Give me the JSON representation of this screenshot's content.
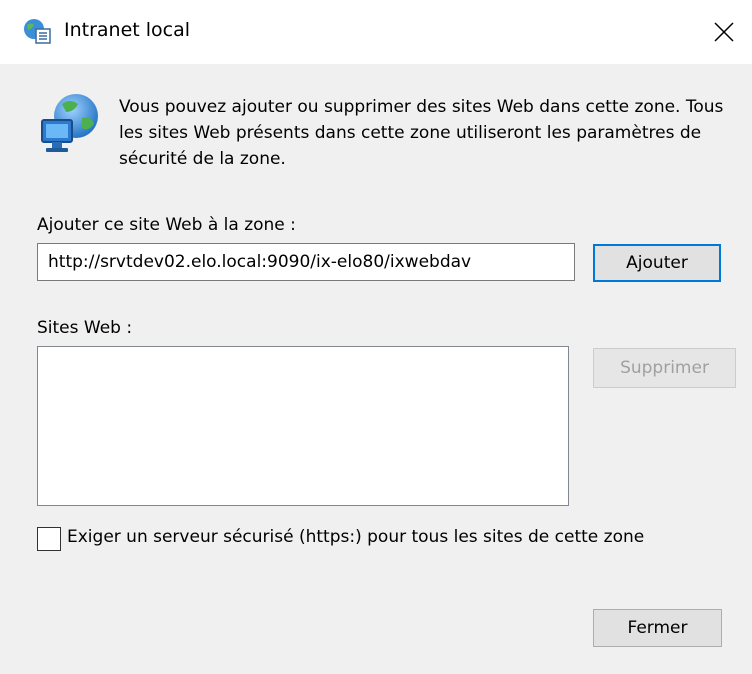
{
  "window": {
    "title": "Intranet local",
    "icon": "globe-list-icon",
    "close_icon": "close-icon"
  },
  "intro": {
    "icon": "globe-computer-icon",
    "text": "Vous pouvez ajouter ou supprimer des sites Web dans cette zone. Tous les sites Web présents dans cette zone utiliseront les paramètres de sécurité de la zone."
  },
  "add_site": {
    "label": "Ajouter ce site Web à la zone :",
    "value": "http://srvtdev02.elo.local:9090/ix-elo80/ixwebdav",
    "button": "Ajouter"
  },
  "sites": {
    "label": "Sites Web :",
    "items": [],
    "remove_button": "Supprimer"
  },
  "https_option": {
    "label": "Exiger un serveur sécurisé (https:) pour tous les sites de cette zone",
    "checked": false
  },
  "footer": {
    "close_button": "Fermer"
  },
  "colors": {
    "background": "#f0f0f0",
    "titlebar": "#ffffff",
    "default_button_border": "#0078d7",
    "disabled_text": "#a0a0a0"
  }
}
